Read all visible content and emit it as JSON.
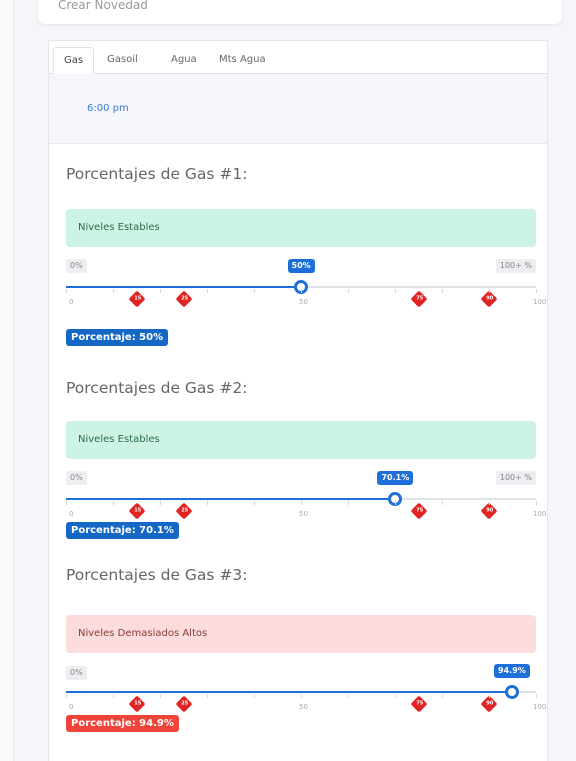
{
  "header": {
    "title": "Crear Novedad"
  },
  "tabs": [
    {
      "label": "Gas"
    },
    {
      "label": "Gasoil"
    },
    {
      "label": "Agua"
    },
    {
      "label": "Mts Agua"
    }
  ],
  "time": "6:00 pm",
  "colors": {
    "accent": "#1e6fd9",
    "ok_bg": "#cdf3e4",
    "bad_bg": "#fcdcdc",
    "marker": "#e02424",
    "badge_blue": "#1567c5",
    "badge_red": "#f04438"
  },
  "sliders": [
    {
      "title": "Porcentajes de Gas #1:",
      "status": "Niveles Estables",
      "status_level": "ok",
      "min_label": "0%",
      "max_label": "100+ %",
      "value": 50,
      "value_label": "50%",
      "badge": "Porcentaje: 50%",
      "badge_color": "blue",
      "ticks": [
        "0",
        "50",
        "100"
      ],
      "markers": [
        {
          "value": 15,
          "label": "15"
        },
        {
          "value": 25,
          "label": "25"
        },
        {
          "value": 75,
          "label": "75"
        },
        {
          "value": 90,
          "label": "90"
        }
      ]
    },
    {
      "title": "Porcentajes de Gas #2:",
      "status": "Niveles Estables",
      "status_level": "ok",
      "min_label": "0%",
      "max_label": "100+ %",
      "value": 70.1,
      "value_label": "70.1%",
      "badge": "Porcentaje: 70.1%",
      "badge_color": "blue",
      "ticks": [
        "0",
        "50",
        "100"
      ],
      "markers": [
        {
          "value": 15,
          "label": "15"
        },
        {
          "value": 25,
          "label": "25"
        },
        {
          "value": 75,
          "label": "75"
        },
        {
          "value": 90,
          "label": "90"
        }
      ]
    },
    {
      "title": "Porcentajes de Gas #3:",
      "status": "Niveles Demasiados Altos",
      "status_level": "bad",
      "min_label": "0%",
      "max_label": "",
      "value": 94.9,
      "value_label": "94.9%",
      "badge": "Porcentaje: 94.9%",
      "badge_color": "red",
      "ticks": [
        "0",
        "50",
        "100"
      ],
      "markers": [
        {
          "value": 15,
          "label": "15"
        },
        {
          "value": 25,
          "label": "25"
        },
        {
          "value": 75,
          "label": "75"
        },
        {
          "value": 90,
          "label": "90"
        }
      ]
    }
  ]
}
